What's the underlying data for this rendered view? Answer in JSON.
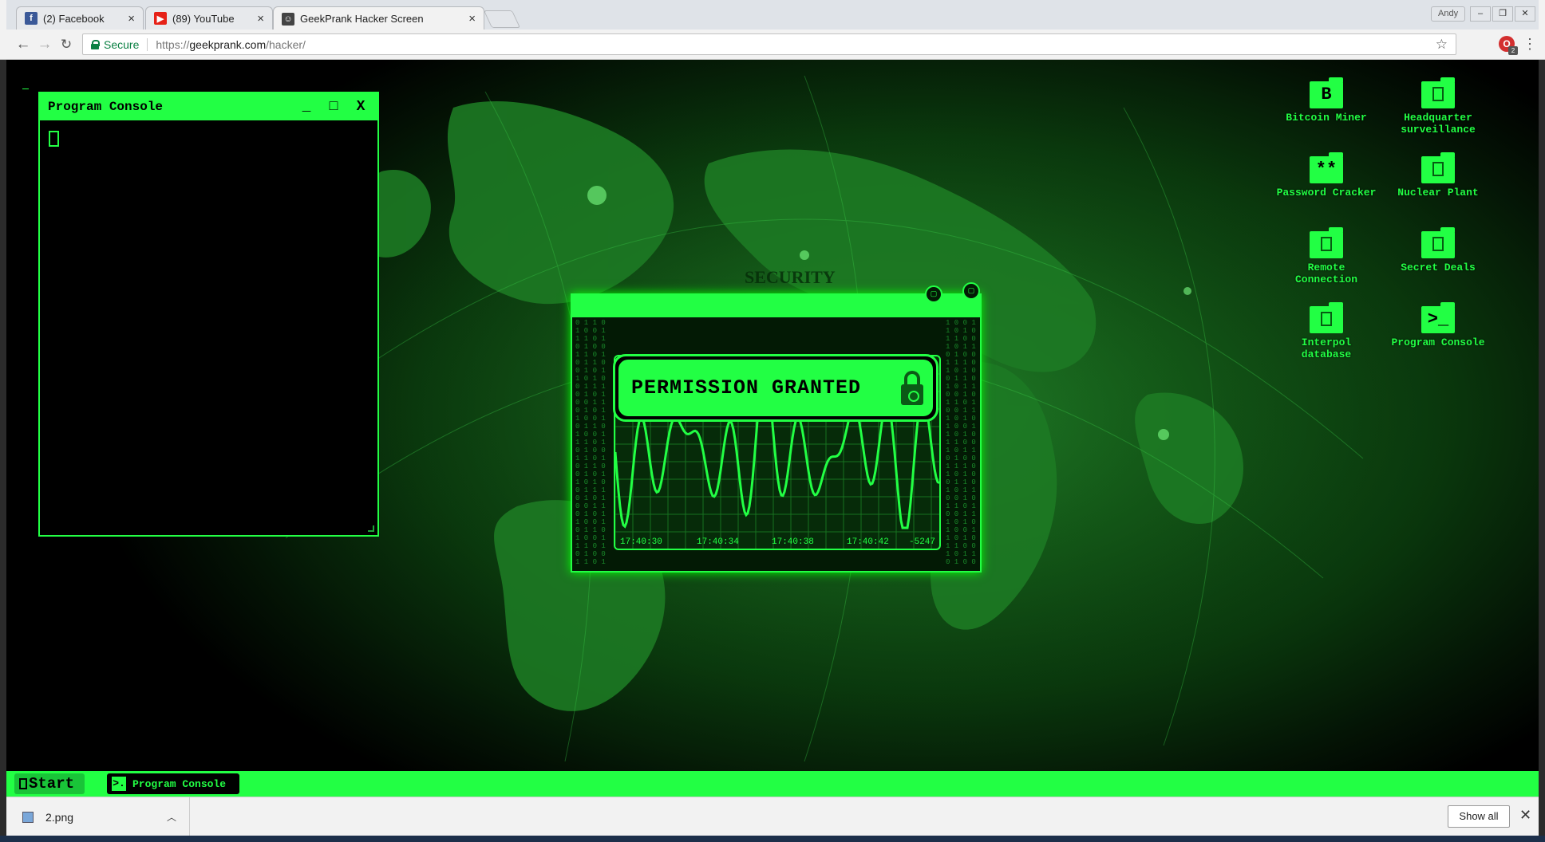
{
  "browser": {
    "tabs": [
      {
        "label": "(2) Facebook",
        "favicon": "facebook-icon",
        "color": "#3b5998"
      },
      {
        "label": "(89) YouTube",
        "favicon": "youtube-icon",
        "color": "#e62117"
      },
      {
        "label": "GeekPrank Hacker Screen",
        "favicon": "geekprank-icon",
        "color": "#444444"
      }
    ],
    "profile_name": "Andy",
    "address": {
      "secure_label": "Secure",
      "scheme": "https://",
      "host": "geekprank.com",
      "path": "/hacker/"
    },
    "extension_badge": "2"
  },
  "desktop": {
    "console_window": {
      "title": "Program Console",
      "minimize": "_",
      "maximize": "□",
      "close": "X"
    },
    "permission_banner": "PERMISSION GRANTED",
    "chart_data": {
      "type": "line",
      "x": [
        "17:40:30",
        "17:40:34",
        "17:40:38",
        "17:40:42"
      ],
      "corner_value": "-5247"
    },
    "icons": [
      {
        "label": "Bitcoin Miner",
        "glyph": "B"
      },
      {
        "label": "Headquarter surveillance",
        "glyph": ""
      },
      {
        "label": "Password Cracker",
        "glyph": "**"
      },
      {
        "label": "Nuclear Plant",
        "glyph": ""
      },
      {
        "label": "Remote Connection",
        "glyph": ""
      },
      {
        "label": "Secret Deals",
        "glyph": ""
      },
      {
        "label": "Interpol database",
        "glyph": ""
      },
      {
        "label": "Program Console",
        "glyph": ">_"
      }
    ],
    "accent_color": "#22ff44"
  },
  "taskbar": {
    "start_label": "Start",
    "tasks": [
      {
        "label": "Program Console",
        "icon": ">."
      }
    ]
  },
  "download_shelf": {
    "filename": "2.png",
    "show_all": "Show all"
  }
}
